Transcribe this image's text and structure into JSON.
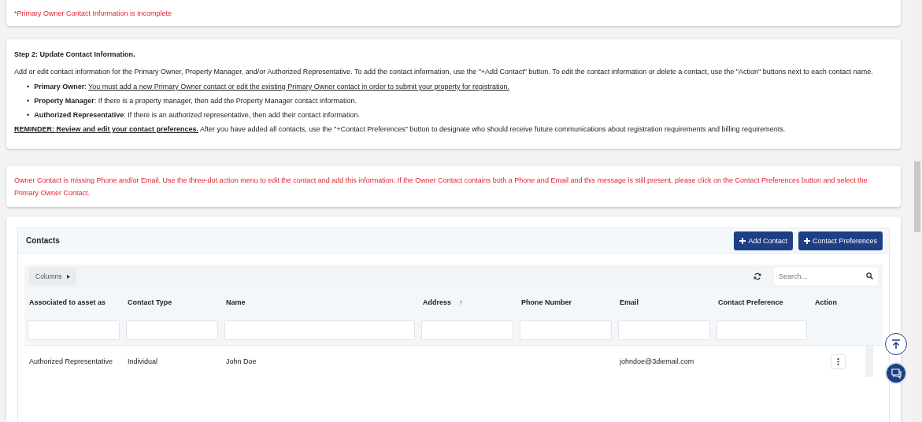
{
  "alert": {
    "text": "*Primary Owner Contact Information is Incomplete"
  },
  "instructions": {
    "heading": "Step 2: Update Contact Information.",
    "intro": "Add or edit contact information for the Primary Owner, Property Manager, and/or Authorized Representative. To add the contact information, use the \"+Add Contact\" button. To edit the contact information or delete a contact, use the \"Action\" buttons next to each contact name.",
    "bullets": [
      {
        "marker": "•",
        "label": "Primary Owner",
        "separator": ":",
        "text": "You must add a new Primary Owner contact or edit the existing Primary Owner contact in order to submit your property for registration.",
        "underlined": true
      },
      {
        "marker": "•",
        "label": "Property Manager",
        "separator": ":",
        "text": "If there is a property manager, then add the Property Manager contact information.",
        "underlined": false
      },
      {
        "marker": "•",
        "label": "Authorized Representative",
        "separator": ":",
        "text": "If there is an authorized representative, then add their contact information.",
        "underlined": false
      }
    ],
    "reminder": {
      "lead": "REMINDER: Review and edit your contact preferences.",
      "text": "After you have added all contacts, use the \"+Contact Preferences\" button to designate who should receive future communications about registration requirements and billing requirements."
    }
  },
  "warning": {
    "text": "Owner Contact is missing Phone and/or Email. Use the three-dot action menu to edit the contact and add this information. If the Owner Contact contains both a Phone and Email and this message is still present, please click on the Contact Preferences button and select the Primary Owner Contact."
  },
  "contacts": {
    "title": "Contacts",
    "buttons": [
      "Add Contact",
      "Contact Preferences"
    ],
    "columns_button": "Columns",
    "search": {
      "placeholder": "Search..."
    },
    "columns": [
      {
        "label": "Associated to asset as",
        "filterable": true
      },
      {
        "label": "Contact Type",
        "filterable": true
      },
      {
        "label": "Name",
        "filterable": true
      },
      {
        "label": "Address",
        "filterable": true,
        "sort_mark": "↑"
      },
      {
        "label": "Phone Number",
        "filterable": true
      },
      {
        "label": "Email",
        "filterable": true
      },
      {
        "label": "Contact Preference",
        "filterable": true
      },
      {
        "label": "Action",
        "filterable": false,
        "kind": "action"
      }
    ],
    "rows": [
      {
        "cells": [
          "Authorized Representative",
          "Individual",
          "John Doe",
          null,
          null,
          "johndoe@3diemail.com",
          null
        ]
      }
    ]
  }
}
